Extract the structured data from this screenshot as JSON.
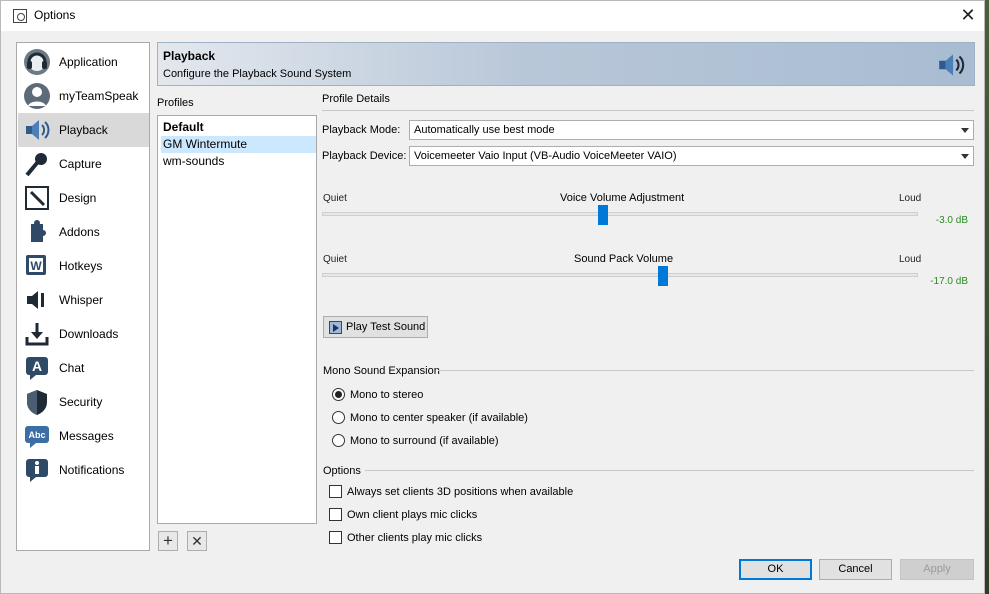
{
  "window": {
    "title": "Options"
  },
  "sidebar": {
    "items": [
      {
        "label": "Application",
        "icon": "teamspeak-headset-icon"
      },
      {
        "label": "myTeamSpeak",
        "icon": "user-profile-icon"
      },
      {
        "label": "Playback",
        "icon": "speaker-icon",
        "active": true
      },
      {
        "label": "Capture",
        "icon": "microphone-icon"
      },
      {
        "label": "Design",
        "icon": "pencil-design-icon"
      },
      {
        "label": "Addons",
        "icon": "puzzle-addons-icon"
      },
      {
        "label": "Hotkeys",
        "icon": "keyboard-w-icon"
      },
      {
        "label": "Whisper",
        "icon": "whisper-speaker-icon"
      },
      {
        "label": "Downloads",
        "icon": "download-icon"
      },
      {
        "label": "Chat",
        "icon": "chat-a-icon"
      },
      {
        "label": "Security",
        "icon": "shield-icon"
      },
      {
        "label": "Messages",
        "icon": "abc-messages-icon"
      },
      {
        "label": "Notifications",
        "icon": "info-icon"
      }
    ]
  },
  "header": {
    "title": "Playback",
    "subtitle": "Configure the Playback Sound System",
    "icon": "speaker-icon"
  },
  "profiles": {
    "label": "Profiles",
    "items": [
      {
        "name": "Default",
        "default": true
      },
      {
        "name": "GM Wintermute",
        "selected": true
      },
      {
        "name": "wm-sounds"
      }
    ],
    "add_icon": "plus-icon",
    "remove_icon": "x-icon"
  },
  "details": {
    "label": "Profile Details",
    "mode_label": "Playback Mode:",
    "mode_value": "Automatically use best mode",
    "device_label": "Playback Device:",
    "device_value": "Voicemeeter Vaio Input (VB-Audio VoiceMeeter VAIO)",
    "voice_slider": {
      "title": "Voice Volume Adjustment",
      "min_label": "Quiet",
      "max_label": "Loud",
      "value": "-3.0 dB",
      "position": 0.47
    },
    "pack_slider": {
      "title": "Sound Pack Volume",
      "min_label": "Quiet",
      "max_label": "Loud",
      "value": "-17.0 dB",
      "position": 0.57
    },
    "play_test_label": "Play Test Sound"
  },
  "mono": {
    "label": "Mono Sound Expansion",
    "options": [
      {
        "label": "Mono to stereo",
        "checked": true
      },
      {
        "label": "Mono to center speaker (if available)",
        "checked": false
      },
      {
        "label": "Mono to surround (if available)",
        "checked": false
      }
    ]
  },
  "options": {
    "label": "Options",
    "checks": [
      {
        "label": "Always set clients 3D positions when available",
        "checked": false
      },
      {
        "label": "Own client plays mic clicks",
        "checked": false
      },
      {
        "label": "Other clients play mic clicks",
        "checked": false
      }
    ]
  },
  "buttons": {
    "ok": "OK",
    "cancel": "Cancel",
    "apply": "Apply"
  },
  "colors": {
    "accent": "#0078d7",
    "db_text": "#2b8a24",
    "header_gradient_end": "#a8bcd2"
  }
}
